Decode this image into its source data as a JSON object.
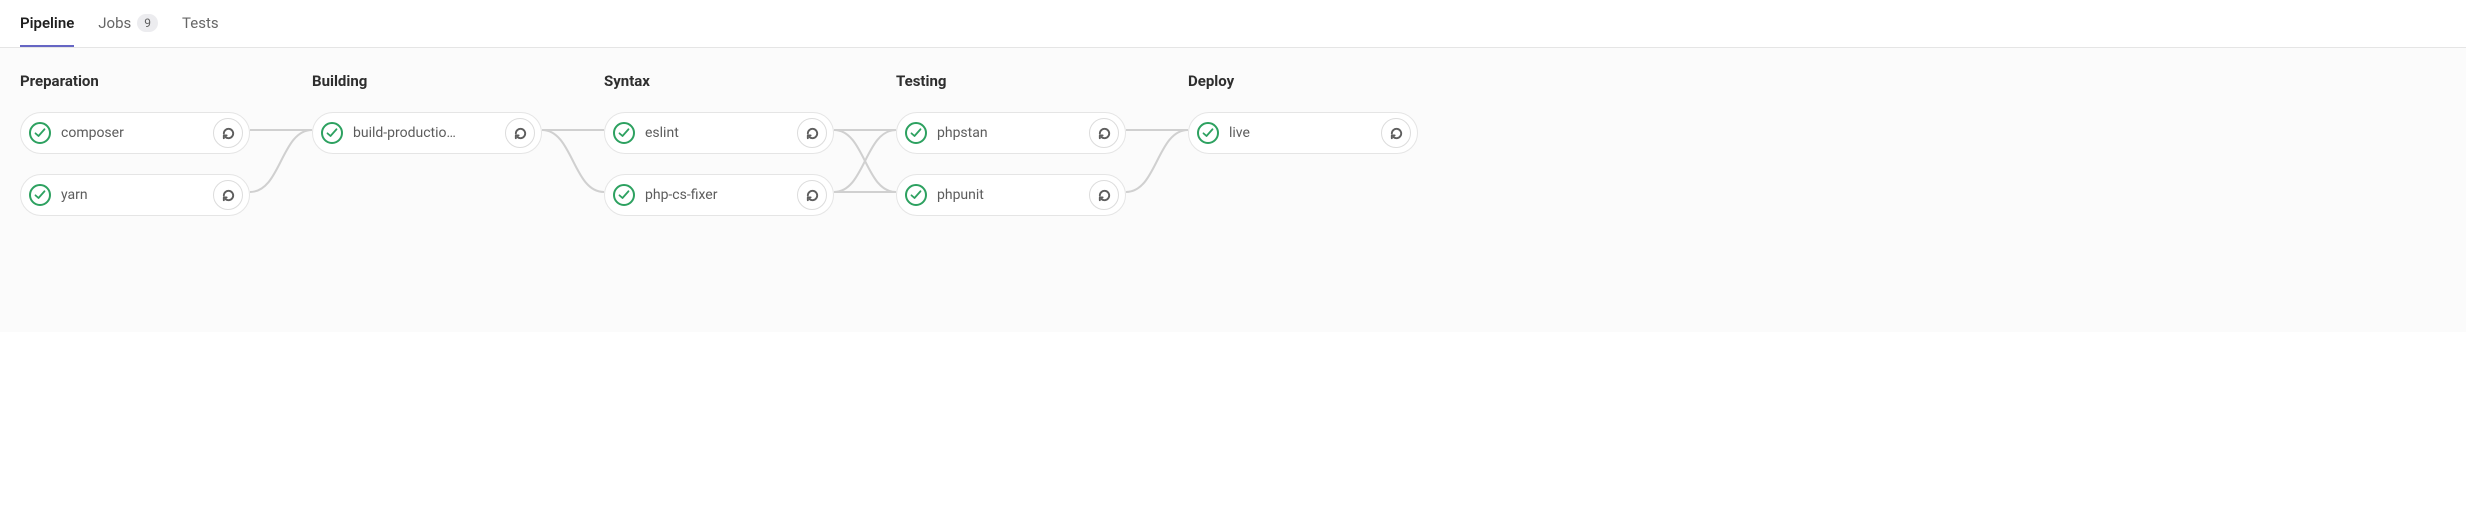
{
  "tabs": {
    "pipeline": "Pipeline",
    "jobs": "Jobs",
    "jobs_count": "9",
    "tests": "Tests"
  },
  "stages": [
    {
      "title": "Preparation",
      "jobs": [
        {
          "name": "composer"
        },
        {
          "name": "yarn"
        }
      ]
    },
    {
      "title": "Building",
      "jobs": [
        {
          "name": "build-productio…"
        }
      ]
    },
    {
      "title": "Syntax",
      "jobs": [
        {
          "name": "eslint"
        },
        {
          "name": "php-cs-fixer"
        }
      ]
    },
    {
      "title": "Testing",
      "jobs": [
        {
          "name": "phpstan"
        },
        {
          "name": "phpunit"
        }
      ]
    },
    {
      "title": "Deploy",
      "jobs": [
        {
          "name": "live"
        }
      ]
    }
  ]
}
